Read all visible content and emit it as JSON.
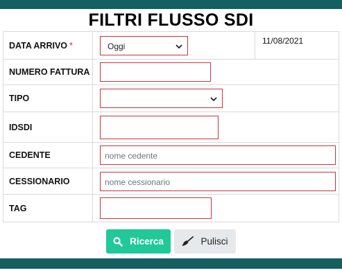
{
  "page": {
    "title": "FILTRI FLUSSO SDI"
  },
  "form": {
    "data_arrivo": {
      "label": "DATA ARRIVO",
      "required_mark": "*",
      "selected": "Oggi",
      "date": "11/08/2021"
    },
    "numero_fattura": {
      "label": "NUMERO FATTURA",
      "value": ""
    },
    "tipo": {
      "label": "TIPO",
      "selected": ""
    },
    "idsdi": {
      "label": "IDSDI",
      "value": ""
    },
    "cedente": {
      "label": "CEDENTE",
      "placeholder": "nome cedente",
      "value": ""
    },
    "cessionario": {
      "label": "CESSIONARIO",
      "placeholder": "nome cessionario",
      "value": ""
    },
    "tag": {
      "label": "TAG",
      "value": ""
    }
  },
  "actions": {
    "search_label": "Ricerca",
    "clear_label": "Pulisci"
  },
  "colors": {
    "header_bar": "#145f60",
    "search_button": "#20c997",
    "clear_button": "#e6e9ec",
    "field_border": "#c9343e",
    "required": "#d9232d"
  },
  "icons": {
    "search": "search-icon",
    "clear": "broom-icon",
    "dropdown": "chevron-down-icon"
  }
}
